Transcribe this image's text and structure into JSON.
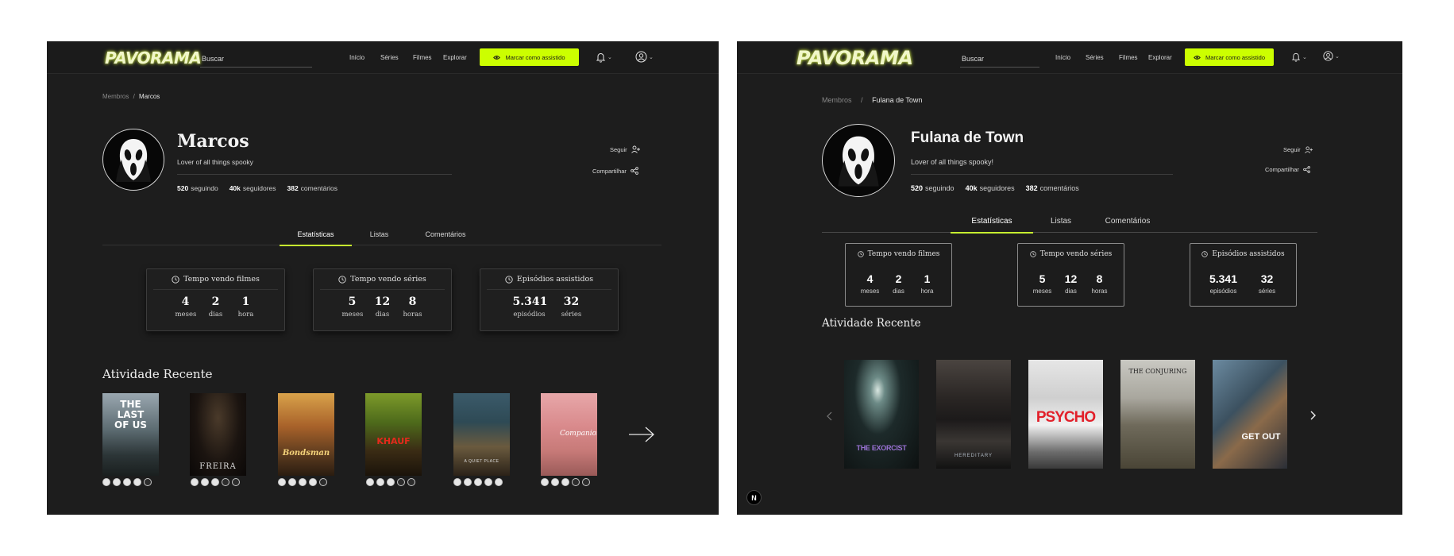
{
  "brand": {
    "name": "PAVORAMA",
    "accent": "#ccff00"
  },
  "nav": {
    "search_placeholder": "Buscar",
    "links": [
      "Início",
      "Séries",
      "Filmes",
      "Explorar"
    ],
    "cta_label": "Marcar como assistido",
    "icons": [
      "eye-icon",
      "bell-icon",
      "user-circle-icon",
      "chevron-down-icon"
    ]
  },
  "left": {
    "breadcrumb": {
      "parent": "Membros",
      "sep": "/",
      "current": "Marcos"
    },
    "profile": {
      "name": "Marcos",
      "bio": "Lover of all things spooky",
      "following": "520",
      "following_label": "seguindo",
      "followers": "40k",
      "followers_label": "seguidores",
      "comments": "382",
      "comments_label": "comentários"
    },
    "actions": {
      "follow": "Seguir",
      "share": "Compartilhar"
    },
    "tabs": [
      "Estatísticas",
      "Listas",
      "Comentários"
    ],
    "stats_cards": [
      {
        "title": "Tempo vendo filmes",
        "values": [
          {
            "n": "4",
            "u": "meses"
          },
          {
            "n": "2",
            "u": "dias"
          },
          {
            "n": "1",
            "u": "hora"
          }
        ]
      },
      {
        "title": "Tempo vendo séries",
        "values": [
          {
            "n": "5",
            "u": "meses"
          },
          {
            "n": "12",
            "u": "dias"
          },
          {
            "n": "8",
            "u": "horas"
          }
        ]
      },
      {
        "title": "Episódios assistidos",
        "values": [
          {
            "n": "5.341",
            "u": "episódios"
          },
          {
            "n": "32",
            "u": "séries"
          }
        ]
      }
    ],
    "recent_title": "Atividade Recente",
    "posters": [
      {
        "title": "THE LAST OF US",
        "rating": 4
      },
      {
        "title": "FREIRA",
        "rating": 3
      },
      {
        "title": "Bondsman",
        "rating": 4
      },
      {
        "title": "KHAUF",
        "rating": 3
      },
      {
        "title": "A QUIET PLACE",
        "rating": 5
      },
      {
        "title": "Companion",
        "rating": 3
      }
    ]
  },
  "right": {
    "breadcrumb": {
      "parent": "Membros",
      "sep": "/",
      "current": "Fulana de Town"
    },
    "profile": {
      "name": "Fulana de Town",
      "bio": "Lover of all things spooky!",
      "following": "520",
      "following_label": "seguindo",
      "followers": "40k",
      "followers_label": "seguidores",
      "comments": "382",
      "comments_label": "comentários"
    },
    "actions": {
      "follow": "Seguir",
      "share": "Compartilhar"
    },
    "tabs": [
      "Estatísticas",
      "Listas",
      "Comentários"
    ],
    "stats_cards": [
      {
        "title": "Tempo vendo filmes",
        "values": [
          {
            "n": "4",
            "u": "meses"
          },
          {
            "n": "2",
            "u": "dias"
          },
          {
            "n": "1",
            "u": "hora"
          }
        ]
      },
      {
        "title": "Tempo vendo séries",
        "values": [
          {
            "n": "5",
            "u": "meses"
          },
          {
            "n": "12",
            "u": "dias"
          },
          {
            "n": "8",
            "u": "horas"
          }
        ]
      },
      {
        "title": "Episódios assistidos",
        "values": [
          {
            "n": "5.341",
            "u": "episódios"
          },
          {
            "n": "32",
            "u": "séries"
          }
        ]
      }
    ],
    "recent_title": "Atividade Recente",
    "posters": [
      {
        "title": "THE EXORCIST"
      },
      {
        "title": "HEREDITARY"
      },
      {
        "title": "PSYCHO"
      },
      {
        "title": "THE CONJURING"
      },
      {
        "title": "GET OUT"
      }
    ],
    "badge": "N"
  }
}
